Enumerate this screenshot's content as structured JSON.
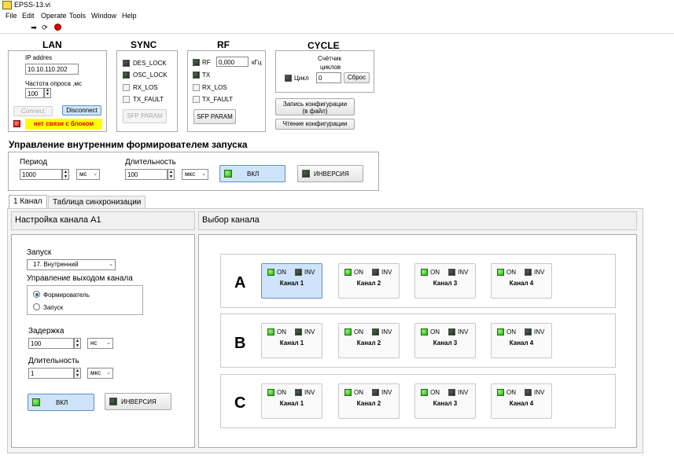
{
  "window": {
    "title": "EPSS-13.vi"
  },
  "menu": [
    "File",
    "Edit",
    "Operate",
    "Tools",
    "Window",
    "Help"
  ],
  "toolbar": {
    "run_icon": "run-arrow-icon",
    "run_continuous_icon": "run-continuous-icon",
    "abort_icon": "abort-stop-icon"
  },
  "lan": {
    "title": "LAN",
    "ip_label": "IP addres",
    "ip_value": "10.10.110.202",
    "poll_label": "Частота опроса ,мс",
    "poll_value": "100",
    "connect_label": "Connect",
    "disconnect_label": "Disconnect",
    "status_text": "нет связи с блоком",
    "status_color": "#ffff00",
    "status_text_color": "#d40000"
  },
  "sync": {
    "title": "SYNC",
    "indicators": [
      "DES_LOCK",
      "OSC_LOCK",
      "RX_LOS",
      "TX_FAULT"
    ],
    "sfp_label": "SFP PARAM"
  },
  "rf": {
    "title": "RF",
    "rf_label": "RF",
    "freq_value": "0,000",
    "freq_unit": "кГц",
    "tx_label": "TX",
    "rx_los_label": "RX_LOS",
    "tx_fault_label": "TX_FAULT",
    "sfp_label": "SFP PARAM"
  },
  "cycle": {
    "title": "CYCLE",
    "counter_label": "Счётчик циклов",
    "counter_label_l1": "Счётчик",
    "counter_label_l2": "циклов",
    "cycle_label": "Цикл",
    "counter_value": "0",
    "reset_label": "Сброс",
    "save_label_l1": "Запись конфигурации",
    "save_label_l2": "(в файл)",
    "load_label": "Чтение конфигурации"
  },
  "internal": {
    "title": "Управление внутренним формирователем запуска",
    "period_label": "Период",
    "period_value": "1000",
    "period_unit": "мс",
    "duration_label": "Длительность",
    "duration_value": "100",
    "duration_unit": "мкс",
    "on_label": "ВКЛ",
    "invert_label": "ИНВЕРСИЯ"
  },
  "tabs": [
    "1 Канал",
    "Таблица синхронизации"
  ],
  "channel_setup": {
    "header": "Настройка канала А1",
    "trigger_label": "Запуск",
    "trigger_value": "17. Внутренний",
    "output_label": "Управление выходом канала",
    "radio_shaper": "Формирователь",
    "radio_trigger": "Запуск",
    "delay_label": "Задержка",
    "delay_value": "100",
    "delay_unit": "нс",
    "duration_label": "Длительность",
    "duration_value": "1",
    "duration_unit": "мкс",
    "on_label": "ВКЛ",
    "invert_label": "ИНВЕРСИЯ"
  },
  "channel_select": {
    "header": "Выбор канала",
    "rows": [
      {
        "letter": "A",
        "channels": [
          "Канал 1",
          "Канал 2",
          "Канал 3",
          "Канал 4"
        ]
      },
      {
        "letter": "B",
        "channels": [
          "Канал 1",
          "Канал 2",
          "Канал 3",
          "Канал 4"
        ]
      },
      {
        "letter": "C",
        "channels": [
          "Канал 1",
          "Канал 2",
          "Канал 3",
          "Канал 4"
        ]
      }
    ],
    "on_label": "ON",
    "inv_label": "INV"
  }
}
